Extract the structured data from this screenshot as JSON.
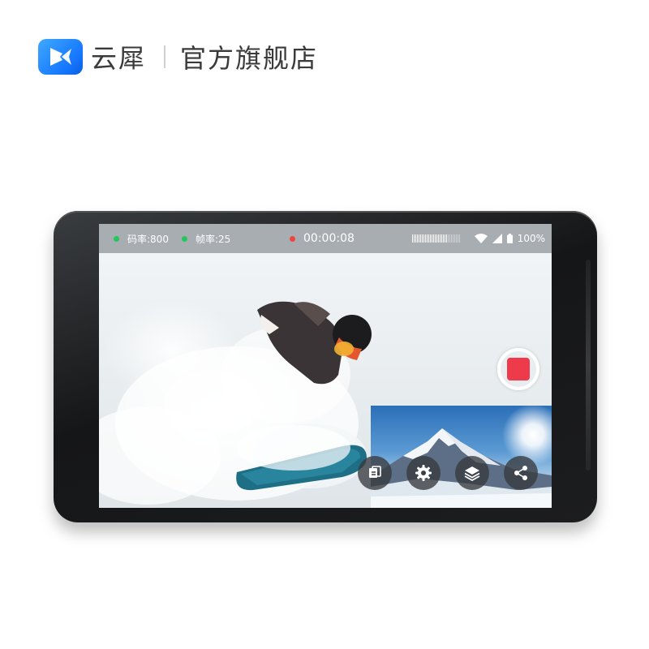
{
  "brand": {
    "name": "云犀",
    "store_label": "官方旗舰店",
    "logo_icon": "play-bird-logo-icon",
    "accent_color": "#1677ff"
  },
  "status_bar": {
    "bitrate_label": "码率:800",
    "framerate_label": "帧率:25",
    "recording_time": "00:00:08",
    "battery_text": "100%",
    "indicator_colors": {
      "stats": "#22c55e",
      "recording": "#ef4444"
    }
  },
  "controls": {
    "record_icon": "record-stop-icon",
    "record_color": "#ee3b4c",
    "tools": [
      {
        "name": "switch-source",
        "icon": "switch-icon"
      },
      {
        "name": "settings",
        "icon": "gear-icon"
      },
      {
        "name": "layers",
        "icon": "layers-icon"
      },
      {
        "name": "share",
        "icon": "share-icon"
      }
    ]
  }
}
